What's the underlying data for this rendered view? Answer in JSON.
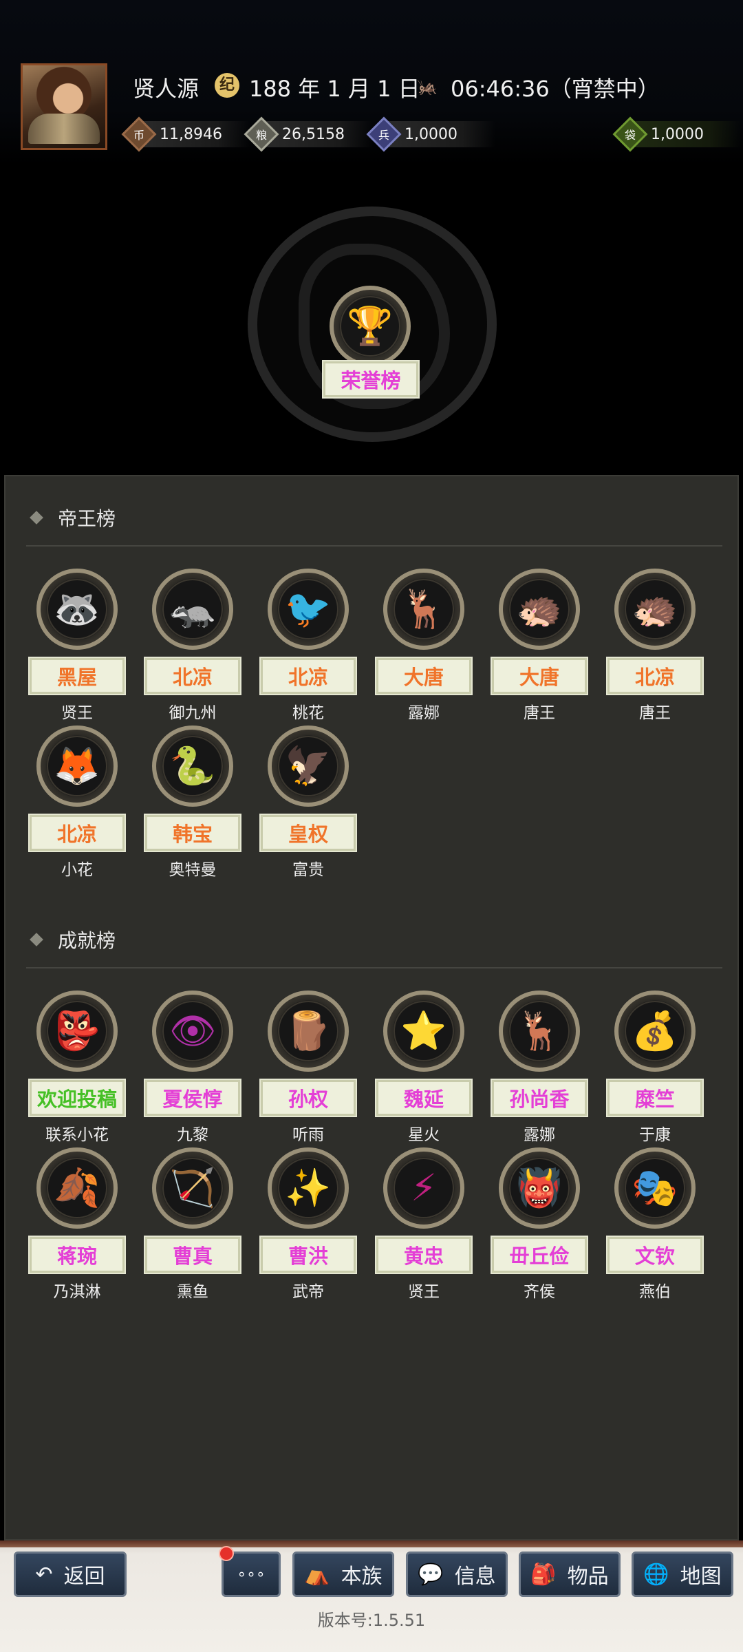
{
  "header": {
    "player_name": "贤人源",
    "date_icon": "calendar-seal-icon",
    "date": "188 年 1 月 1 日",
    "time_icon": "grasshopper-icon",
    "time": "06:46:36（宵禁中）",
    "resources": [
      {
        "name": "coin-icon",
        "value": "11,8946",
        "color": "#6e4a2f",
        "glyph": "币"
      },
      {
        "name": "grain-icon",
        "value": "26,5158",
        "color": "#7b7b6e",
        "glyph": "粮"
      },
      {
        "name": "soldier-icon",
        "value": "1,0000",
        "color": "#4b4f8f",
        "glyph": "兵"
      },
      {
        "name": "pouch-icon",
        "value": "1,0000",
        "color": "#4c6b22",
        "glyph": "袋"
      }
    ]
  },
  "honor": {
    "icon": "trophy-icon",
    "label": "荣誉榜"
  },
  "sections": {
    "emperor": {
      "title": "帝王榜",
      "items": [
        {
          "icon": "hyena-icon",
          "glyph": "🦝",
          "tag": "黑屋",
          "tag_color": "orange",
          "name": "贤王"
        },
        {
          "icon": "badger-icon",
          "glyph": "🦡",
          "tag": "北凉",
          "tag_color": "orange",
          "name": "御九州"
        },
        {
          "icon": "woodpecker-icon",
          "glyph": "🐦",
          "tag": "北凉",
          "tag_color": "orange",
          "name": "桃花"
        },
        {
          "icon": "deer-icon",
          "glyph": "🦌",
          "tag": "大唐",
          "tag_color": "orange",
          "name": "露娜"
        },
        {
          "icon": "pangolin-icon",
          "glyph": "🦔",
          "tag": "大唐",
          "tag_color": "orange",
          "name": "唐王"
        },
        {
          "icon": "pangolin-green-icon",
          "glyph": "🦔",
          "tag": "北凉",
          "tag_color": "orange",
          "name": "唐王"
        },
        {
          "icon": "fox-icon",
          "glyph": "🦊",
          "tag": "北凉",
          "tag_color": "orange",
          "name": "小花"
        },
        {
          "icon": "cobra-icon",
          "glyph": "🐍",
          "tag": "韩宝",
          "tag_color": "orange",
          "name": "奥特曼"
        },
        {
          "icon": "eagle-icon",
          "glyph": "🦅",
          "tag": "皇权",
          "tag_color": "orange",
          "name": "富贵"
        }
      ]
    },
    "achievement": {
      "title": "成就榜",
      "items": [
        {
          "icon": "gnome-icon",
          "glyph": "👺",
          "tag": "欢迎投稿",
          "tag_color": "green",
          "name": "联系小花"
        },
        {
          "icon": "eye-icon",
          "glyph": "👁",
          "tag": "夏侯惇",
          "tag_color": "pink",
          "name": "九黎"
        },
        {
          "icon": "logs-icon",
          "glyph": "🪵",
          "tag": "孙权",
          "tag_color": "pink",
          "name": "听雨"
        },
        {
          "icon": "ushanka-icon",
          "glyph": "⭐",
          "tag": "魏延",
          "tag_color": "pink",
          "name": "星火"
        },
        {
          "icon": "deer-icon",
          "glyph": "🦌",
          "tag": "孙尚香",
          "tag_color": "pink",
          "name": "露娜"
        },
        {
          "icon": "money-bag-icon",
          "glyph": "💰",
          "tag": "糜竺",
          "tag_color": "pink",
          "name": "于康"
        },
        {
          "icon": "leaf-icon",
          "glyph": "🍂",
          "tag": "蒋琬",
          "tag_color": "pink",
          "name": "乃淇淋"
        },
        {
          "icon": "arrow-icon",
          "glyph": "🏹",
          "tag": "曹真",
          "tag_color": "pink",
          "name": "熏鱼"
        },
        {
          "icon": "sparkle-icon",
          "glyph": "✨",
          "tag": "曹洪",
          "tag_color": "pink",
          "name": "武帝"
        },
        {
          "icon": "lightning-scroll-icon",
          "glyph": "⚡",
          "tag": "黄忠",
          "tag_color": "pink",
          "name": "贤王"
        },
        {
          "icon": "mask-icon",
          "glyph": "👹",
          "tag": "毌丘俭",
          "tag_color": "pink",
          "name": "齐侯"
        },
        {
          "icon": "theater-mask-icon",
          "glyph": "🎭",
          "tag": "文钦",
          "tag_color": "pink",
          "name": "燕伯"
        }
      ]
    }
  },
  "footer": {
    "buttons": [
      {
        "icon": "back-arrow-icon",
        "glyph": "↶",
        "label": "返回"
      },
      {
        "icon": "more-icon",
        "glyph": "∘∘∘",
        "label": ""
      },
      {
        "icon": "clan-icon",
        "glyph": "⛺",
        "label": "本族"
      },
      {
        "icon": "message-icon",
        "glyph": "💬",
        "label": "信息"
      },
      {
        "icon": "items-icon",
        "glyph": "🎒",
        "label": "物品"
      },
      {
        "icon": "map-icon",
        "glyph": "🌐",
        "label": "地图"
      }
    ],
    "version": "版本号:1.5.51"
  }
}
